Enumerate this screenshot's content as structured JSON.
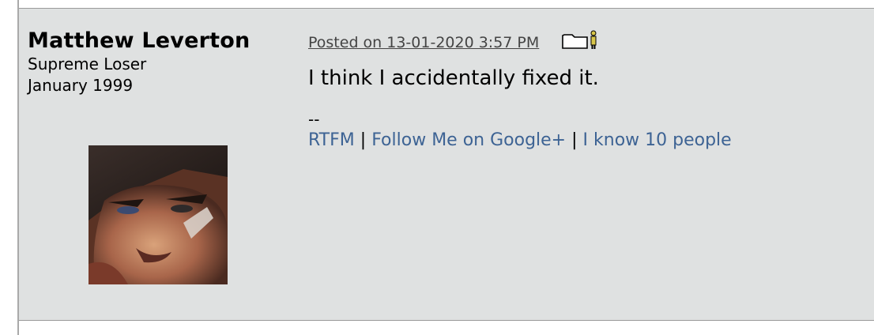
{
  "author": {
    "name": "Matthew Leverton",
    "title": "Supreme Loser",
    "joined": "January 1999",
    "avatar": "avatar-image"
  },
  "post": {
    "date_label": "Posted on 13-01-2020 3:57 PM",
    "body": "I think I accidentally fixed it.",
    "icon": "profile-card-icon"
  },
  "signature": {
    "separator": "--",
    "links": [
      "RTFM",
      "Follow Me on Google+",
      "I know 10 people"
    ],
    "divider": "|"
  },
  "colors": {
    "post_background": "#dfe1e1",
    "link": "#3d6394"
  }
}
